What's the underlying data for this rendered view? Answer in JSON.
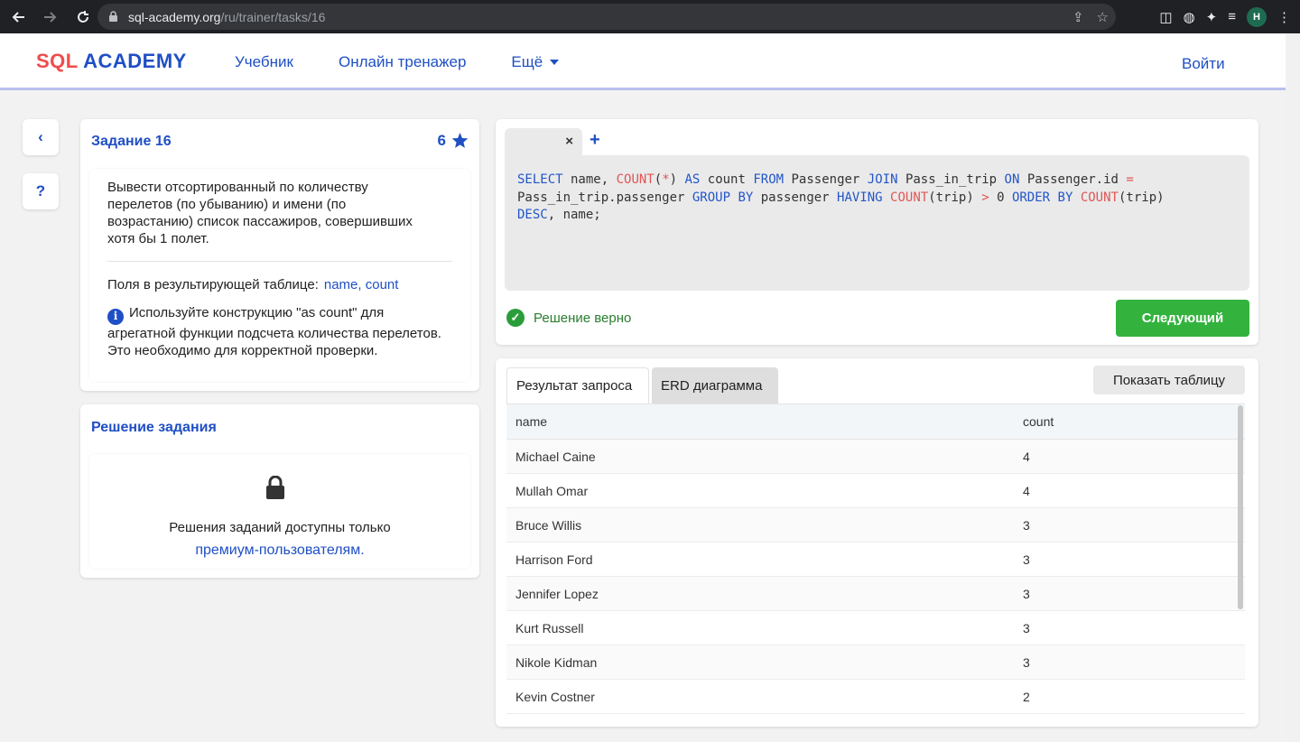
{
  "browser": {
    "url_host": "sql-academy.org",
    "url_path": "/ru/trainer/tasks/16",
    "profile_initial": "H"
  },
  "header": {
    "logo_sql": "SQL",
    "logo_academy": "ACADEMY",
    "nav": [
      "Учебник",
      "Онлайн тренажер",
      "Ещё"
    ],
    "login": "Войти"
  },
  "side": {
    "back": "‹",
    "help": "?"
  },
  "task": {
    "title": "Задание 16",
    "score": "6",
    "text": "Вывести отсортированный по количеству перелетов (по убыванию) и имени (по возрастанию) список пассажиров, совершивших хотя бы 1 полет.",
    "fields_label": "Поля в результирующей таблице:",
    "fields_value": "name, count",
    "hint": "Используйте конструкцию \"as count\" для агрегатной функции подсчета количества перелетов. Это необходимо для корректной проверки."
  },
  "solution": {
    "title": "Решение задания",
    "text": "Решения заданий доступны только",
    "link": "премиум-пользователям."
  },
  "editor": {
    "tab_close": "×",
    "tab_add": "+",
    "status": "Решение верно",
    "next_button": "Следующий"
  },
  "results": {
    "tab_result": "Результат запроса",
    "tab_erd": "ERD диаграмма",
    "show_table": "Показать таблицу",
    "columns": [
      "name",
      "count"
    ],
    "rows": [
      [
        "Michael Caine",
        "4"
      ],
      [
        "Mullah Omar",
        "4"
      ],
      [
        "Bruce Willis",
        "3"
      ],
      [
        "Harrison Ford",
        "3"
      ],
      [
        "Jennifer Lopez",
        "3"
      ],
      [
        "Kurt Russell",
        "3"
      ],
      [
        "Nikole Kidman",
        "3"
      ],
      [
        "Kevin Costner",
        "2"
      ]
    ]
  },
  "colors": {
    "brand_blue": "#1f4fc4",
    "brand_red": "#ef4c4c",
    "success_green": "#33b33e"
  }
}
